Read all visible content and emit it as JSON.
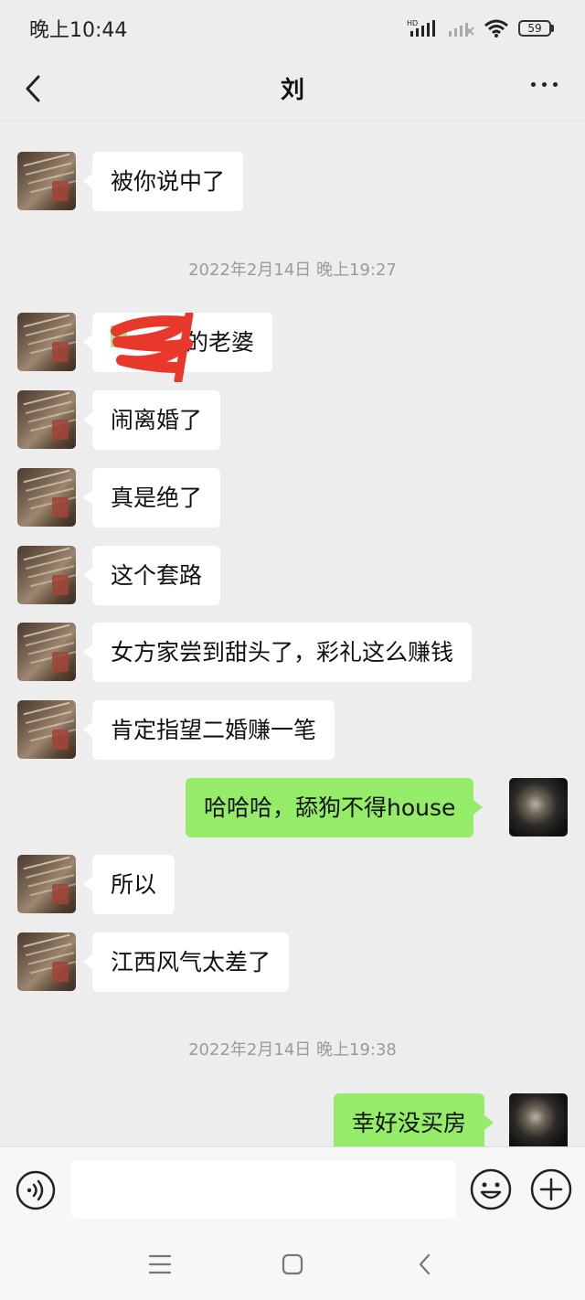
{
  "status_bar": {
    "time": "晚上10:44",
    "battery": "59",
    "hd_label": "HD"
  },
  "header": {
    "title": "刘"
  },
  "messages": [
    {
      "text": "被你说中了"
    },
    {
      "text": "的老婆"
    },
    {
      "text": "闹离婚了"
    },
    {
      "text": "真是绝了"
    },
    {
      "text": "这个套路"
    },
    {
      "text": "女方家尝到甜头了，彩礼这么赚钱"
    },
    {
      "text": "肯定指望二婚赚一笔"
    },
    {
      "text": "哈哈哈，舔狗不得house"
    },
    {
      "text": "所以"
    },
    {
      "text": "江西风气太差了"
    },
    {
      "text": "幸好没买房"
    }
  ],
  "timestamps": [
    "2022年2月14日 晚上19:27",
    "2022年2月14日 晚上19:38"
  ],
  "input": {
    "value": "",
    "placeholder": ""
  },
  "icons": {
    "back": "back-chevron-icon",
    "more": "more-dots-icon",
    "voice": "voice-icon",
    "emoji": "emoji-icon",
    "plus": "plus-icon",
    "menu": "menu-icon",
    "home": "home-icon",
    "sys_back": "system-back-icon"
  },
  "colors": {
    "sent_bubble": "#95ec69",
    "received_bubble": "#ffffff",
    "background": "#ededed",
    "redaction": "#e8382c"
  }
}
